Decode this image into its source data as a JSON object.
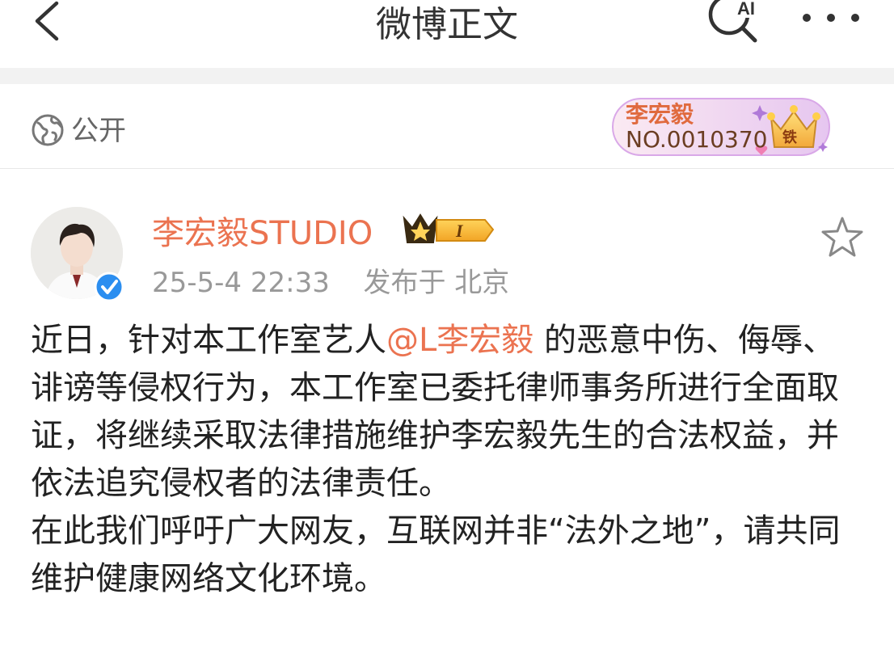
{
  "header": {
    "title": "微博正文",
    "ai_badge": "AI"
  },
  "visibility": {
    "label": "公开"
  },
  "fan_badge": {
    "name": "李宏毅",
    "number": "NO.0010370",
    "level_char": "铁"
  },
  "user": {
    "name": "李宏毅STUDIO",
    "crown_level": "I",
    "timestamp": "25-5-4 22:33",
    "location_prefix": "发布于",
    "location": "北京"
  },
  "post": {
    "text_1": "近日，针对本工作室艺人",
    "mention": "@L李宏毅",
    "text_2": " 的恶意中伤、侮辱、诽谤等侵权行为，本工作室已委托律师事务所进行全面取证，将继续采取法律措施维护李宏毅先生的合法权益，并依法追究侵权者的法律责任。",
    "text_3": "在此我们呼吁广大网友，互联网并非“法外之地”，请共同维护健康网络文化环境。"
  },
  "colors": {
    "accent": "#eb7350",
    "verified": "#2b8ef0",
    "meta": "#999999",
    "separator": "#f2f2f2"
  },
  "icons": {
    "back": "back-icon",
    "ai_search": "ai-search-icon",
    "more": "more-icon",
    "globe": "globe-icon",
    "verified": "verified-icon",
    "crown": "crown-icon",
    "star": "star-icon"
  }
}
